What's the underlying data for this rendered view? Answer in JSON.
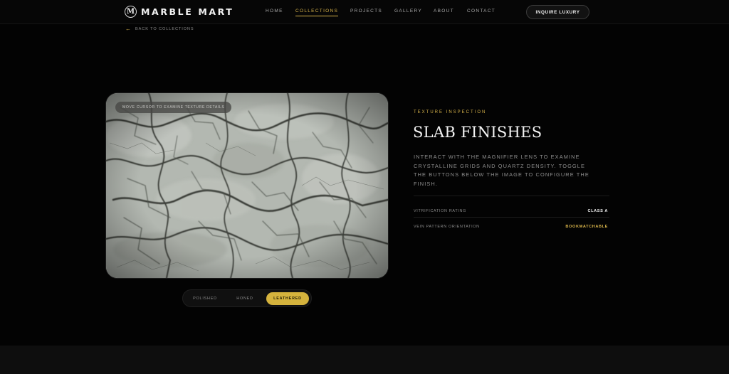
{
  "brand": {
    "mark": "M",
    "name": "MARBLE MART"
  },
  "nav": {
    "items": [
      {
        "label": "HOME",
        "active": false
      },
      {
        "label": "COLLECTIONS",
        "active": true
      },
      {
        "label": "PROJECTS",
        "active": false
      },
      {
        "label": "GALLERY",
        "active": false
      },
      {
        "label": "ABOUT",
        "active": false
      },
      {
        "label": "CONTACT",
        "active": false
      }
    ],
    "cta_label": "INQUIRE LUXURY"
  },
  "back_link": {
    "icon": "arrow-left-icon",
    "label": "BACK TO COLLECTIONS"
  },
  "image": {
    "hint": "MOVE CURSOR TO EXAMINE TEXTURE DETAILS"
  },
  "finish": {
    "options": [
      {
        "label": "POLISHED",
        "active": false
      },
      {
        "label": "HONED",
        "active": false
      },
      {
        "label": "LEATHERED",
        "active": true
      }
    ]
  },
  "panel": {
    "eyebrow": "TEXTURE INSPECTION",
    "title": "SLAB FINISHES",
    "description": "INTERACT WITH THE MAGNIFIER LENS TO EXAMINE CRYSTALLINE GRIDS AND QUARTZ DENSITY. TOGGLE THE BUTTONS BELOW THE IMAGE TO CONFIGURE THE FINISH.",
    "specs": [
      {
        "label": "VITRIFICATION RATING",
        "value": "CLASS A",
        "accent": false
      },
      {
        "label": "VEIN PATTERN ORIENTATION",
        "value": "BOOKMATCHABLE",
        "accent": true
      }
    ]
  },
  "colors": {
    "accent": "#d7b34a",
    "background": "#030303",
    "marble_base": "#a9aea7"
  }
}
